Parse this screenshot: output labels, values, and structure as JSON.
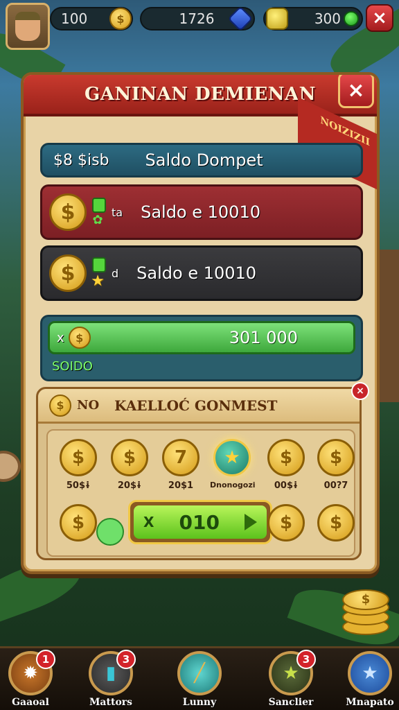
{
  "topbar": {
    "stat1": "100",
    "stat2": "1726",
    "stat3": "300"
  },
  "panel": {
    "title": "GANINAN DEMIENAN",
    "ribbon": "NOIZIZII",
    "close_icon": "×"
  },
  "rows": {
    "teal_prefix": "$8 $isb",
    "teal_label": "Saldo Dompet",
    "red_prefix": "ta",
    "red_label": "Saldo e 10010",
    "dark_prefix": "d",
    "dark_label": "Saldo e 10010",
    "green_prefix": "x",
    "green_value": "301 000",
    "green_sub": "SOIDO"
  },
  "sub": {
    "prefix": "NO",
    "title": "KAELLOĆ GONMEST",
    "cells": [
      {
        "label": "50$ɨ",
        "symbol": "$"
      },
      {
        "label": "20$ɨ",
        "symbol": "$"
      },
      {
        "label": "20$1",
        "symbol": "7"
      },
      {
        "label": "Dnonogozi",
        "symbol": "★"
      },
      {
        "label": "00$ɨ",
        "symbol": "$"
      },
      {
        "label": "00?7",
        "symbol": "$"
      }
    ],
    "claim_prefix": "X",
    "claim_value": "010"
  },
  "nav": [
    {
      "label": "Gaaoal",
      "badge": "1",
      "icon": "leaf-icon"
    },
    {
      "label": "Mattors",
      "badge": "3",
      "icon": "potion-icon"
    },
    {
      "label": "Lunny",
      "badge": "",
      "icon": "stick-icon"
    },
    {
      "label": "Sanclier",
      "badge": "3",
      "icon": "star-icon"
    },
    {
      "label": "Mnapato",
      "badge": "",
      "icon": "star-icon"
    }
  ],
  "colors": {
    "header_red": "#c93a2e",
    "panel_bg": "#e8d3a6",
    "gold": "#d49a16",
    "green": "#5cc21c"
  }
}
